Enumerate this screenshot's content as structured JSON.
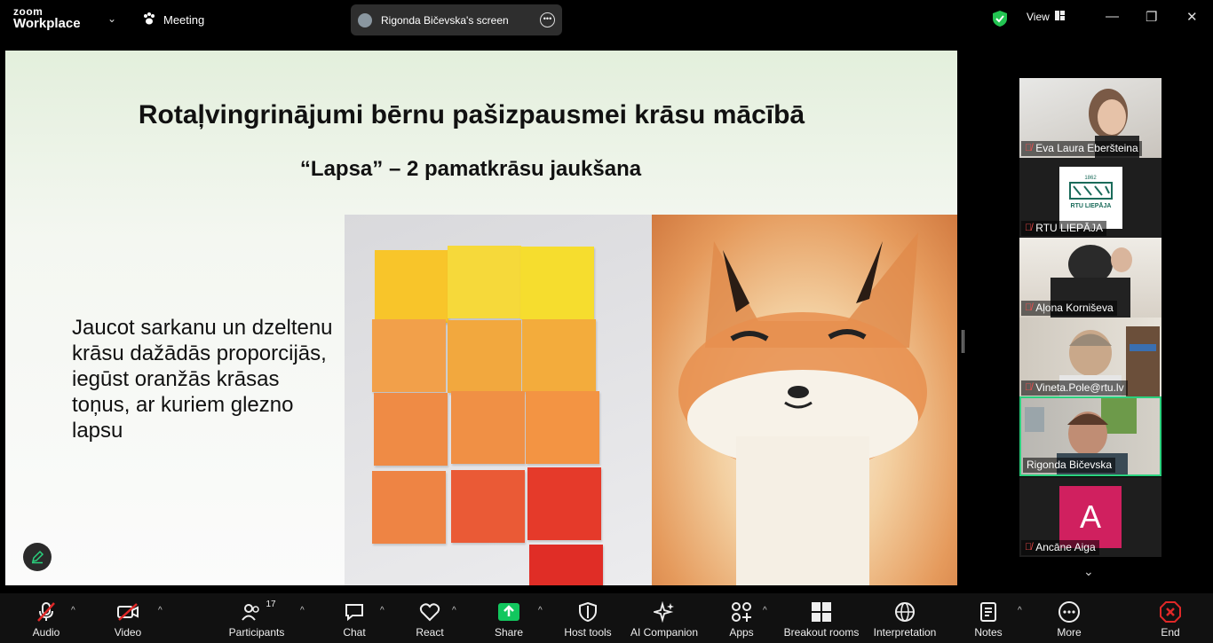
{
  "app": {
    "brand_line1": "zoom",
    "brand_line2": "Workplace",
    "meeting_label": "Meeting",
    "screen_label": "Rigonda Bičevska's screen",
    "view_label": "View"
  },
  "slide": {
    "title": "Rotaļvingrinājumi bērnu pašizpausmei krāsu mācībā",
    "subtitle": "“Lapsa” – 2 pamatkrāsu jaukšana",
    "body": "Jaucot sarkanu un dzeltenu krāsu dažādās proporcijās, iegūst oranžās krāsas toņus, ar kuriem glezno lapsu"
  },
  "participants": [
    {
      "name": "Eva Laura Eberšteina",
      "muted": true
    },
    {
      "name": "RTU LIEPĀJA",
      "muted": true,
      "logo_text": "RTU LIEPĀJA"
    },
    {
      "name": "Aļona Korniševa",
      "muted": true
    },
    {
      "name": "Vineta.Pole@rtu.lv",
      "muted": true
    },
    {
      "name": "Rigonda Bičevska",
      "muted": false
    },
    {
      "name": "Ancāne Aiga",
      "muted": true,
      "initial": "A"
    }
  ],
  "toolbar": {
    "audio": "Audio",
    "video": "Video",
    "participants": "Participants",
    "participants_count": "17",
    "chat": "Chat",
    "react": "React",
    "share": "Share",
    "host_tools": "Host tools",
    "ai_companion": "AI Companion",
    "apps": "Apps",
    "breakout_rooms": "Breakout rooms",
    "interpretation": "Interpretation",
    "notes": "Notes",
    "more": "More",
    "end": "End"
  },
  "colors": {
    "accent_green": "#2ad17e",
    "share_green": "#12c75e",
    "end_red": "#e02828",
    "avatar_pink": "#d0205f"
  }
}
